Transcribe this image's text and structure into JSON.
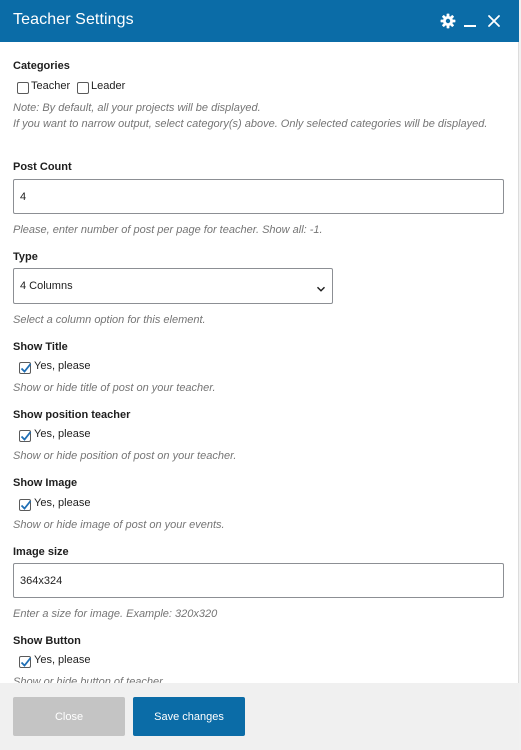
{
  "dialog": {
    "title": "Teacher Settings",
    "icons": {
      "settings": "gear-icon",
      "minimize": "minimize-icon",
      "close": "close-icon"
    }
  },
  "categories": {
    "label": "Categories",
    "options": [
      {
        "label": "Teacher",
        "checked": false
      },
      {
        "label": "Leader",
        "checked": false
      }
    ],
    "note_line1": "Note: By default, all your projects will be displayed.",
    "note_line2": "If you want to narrow output, select category(s) above. Only selected categories will be displayed."
  },
  "post_count": {
    "label": "Post Count",
    "value": "4",
    "note": "Please, enter number of post per page for teacher. Show all: -1."
  },
  "type": {
    "label": "Type",
    "selected": "4 Columns",
    "note": "Select a column option for this element."
  },
  "show_title": {
    "label": "Show Title",
    "checkbox_label": "Yes, please",
    "checked": true,
    "note": "Show or hide title of post on your teacher."
  },
  "show_position": {
    "label": "Show position teacher",
    "checkbox_label": "Yes, please",
    "checked": true,
    "note": "Show or hide position of post on your teacher."
  },
  "show_image": {
    "label": "Show Image",
    "checkbox_label": "Yes, please",
    "checked": true,
    "note": "Show or hide image of post on your events."
  },
  "image_size": {
    "label": "Image size",
    "value": "364x324",
    "note": "Enter a size for image. Example: 320x320"
  },
  "show_button": {
    "label": "Show Button",
    "checkbox_label": "Yes, please",
    "checked": true,
    "note": "Show or hide button of teacher"
  },
  "footer": {
    "close_label": "Close",
    "save_label": "Save changes"
  },
  "colors": {
    "header": "#0b6ca7",
    "primary_button": "#0b6ca7",
    "disabled_button": "#c4c4c4",
    "note_text": "#757575",
    "checkmark": "#1f6fb5"
  }
}
